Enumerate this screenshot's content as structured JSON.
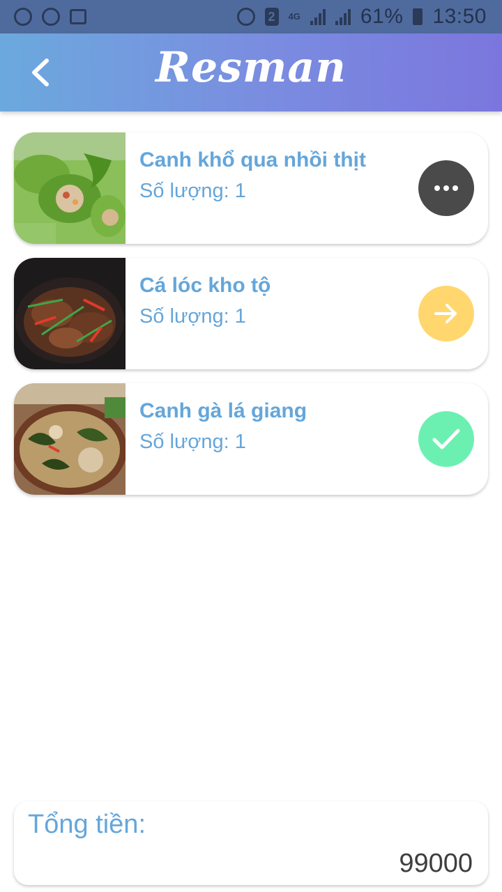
{
  "status_bar": {
    "network": "4G",
    "sim_badge": "2",
    "battery": "61%",
    "time": "13:50"
  },
  "app_bar": {
    "title": "Resman"
  },
  "orders": [
    {
      "name": "Canh khổ qua nhồi thịt",
      "qty_label": "Số lượng:",
      "qty": "1",
      "status": "pending",
      "status_icon": "more-icon",
      "status_color": "#4a4a4a"
    },
    {
      "name": "Cá lóc kho tộ",
      "qty_label": "Số lượng:",
      "qty": "1",
      "status": "in-progress",
      "status_icon": "arrow-right-icon",
      "status_color": "#ffd76e"
    },
    {
      "name": "Canh gà lá giang",
      "qty_label": "Số lượng:",
      "qty": "1",
      "status": "done",
      "status_icon": "check-icon",
      "status_color": "#6cf0b2"
    }
  ],
  "total": {
    "label": "Tổng tiền:",
    "value": "99000"
  },
  "colors": {
    "accent_text": "#64a6da",
    "header_start": "#6ba9dd",
    "header_end": "#7b76de"
  }
}
